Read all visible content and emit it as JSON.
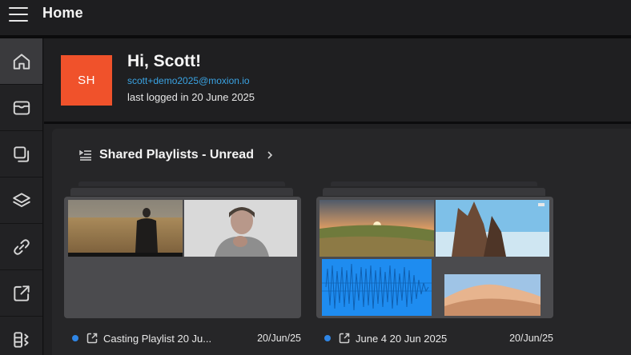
{
  "header": {
    "title": "Home"
  },
  "sidebar": {
    "items": [
      {
        "icon": "home-icon",
        "active": true
      },
      {
        "icon": "inbox-icon",
        "active": false
      },
      {
        "icon": "copy-icon",
        "active": false
      },
      {
        "icon": "layers-icon",
        "active": false
      },
      {
        "icon": "link-icon",
        "active": false
      },
      {
        "icon": "share-icon",
        "active": false
      },
      {
        "icon": "storage-icon",
        "active": false
      }
    ]
  },
  "user": {
    "initials": "SH",
    "greeting": "Hi, Scott!",
    "email": "scott+demo2025@moxion.io",
    "last_login": "last logged in 20 June 2025",
    "avatar_color": "#f0522b"
  },
  "section": {
    "title": "Shared Playlists - Unread"
  },
  "playlists": [
    {
      "name": "Casting Playlist 20 Ju...",
      "date": "20/Jun/25",
      "unread": true
    },
    {
      "name": "June 4 20 Jun 2025",
      "date": "20/Jun/25",
      "unread": true
    }
  ],
  "colors": {
    "accent": "#3aa3e3",
    "unread_dot": "#2f86e6",
    "background": "#1b1b1d"
  }
}
